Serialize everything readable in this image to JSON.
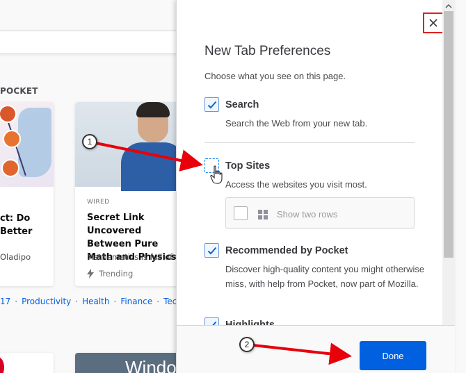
{
  "background": {
    "pocket_heading": "POCKET",
    "card1": {
      "title": "ct: Do Better",
      "author": "Oladipo"
    },
    "card2": {
      "source": "WIRED",
      "title": "Secret Link Uncovered Between Pure Math and Physics",
      "desc": "Mathematics is full of w",
      "trend_label": "Trending"
    },
    "topics": [
      "17",
      "Productivity",
      "Health",
      "Finance",
      "Tec"
    ],
    "card4_text": "Windo"
  },
  "panel": {
    "title": "New Tab Preferences",
    "subtitle": "Choose what you see on this page.",
    "search": {
      "label": "Search",
      "desc": "Search the Web from your new tab.",
      "checked": true
    },
    "top_sites": {
      "label": "Top Sites",
      "desc": "Access the websites you visit most.",
      "checked": false,
      "two_rows_label": "Show two rows"
    },
    "pocket": {
      "label": "Recommended by Pocket",
      "desc": "Discover high-quality content you might otherwise miss, with help from Pocket, now part of Mozilla.",
      "checked": true
    },
    "highlights": {
      "label": "Highlights",
      "checked": true
    },
    "done_label": "Done"
  },
  "annotations": {
    "step1": "1",
    "step2": "2"
  },
  "colors": {
    "accent": "#0060df",
    "arrow": "#e8000b",
    "close_highlight": "#e02020"
  }
}
